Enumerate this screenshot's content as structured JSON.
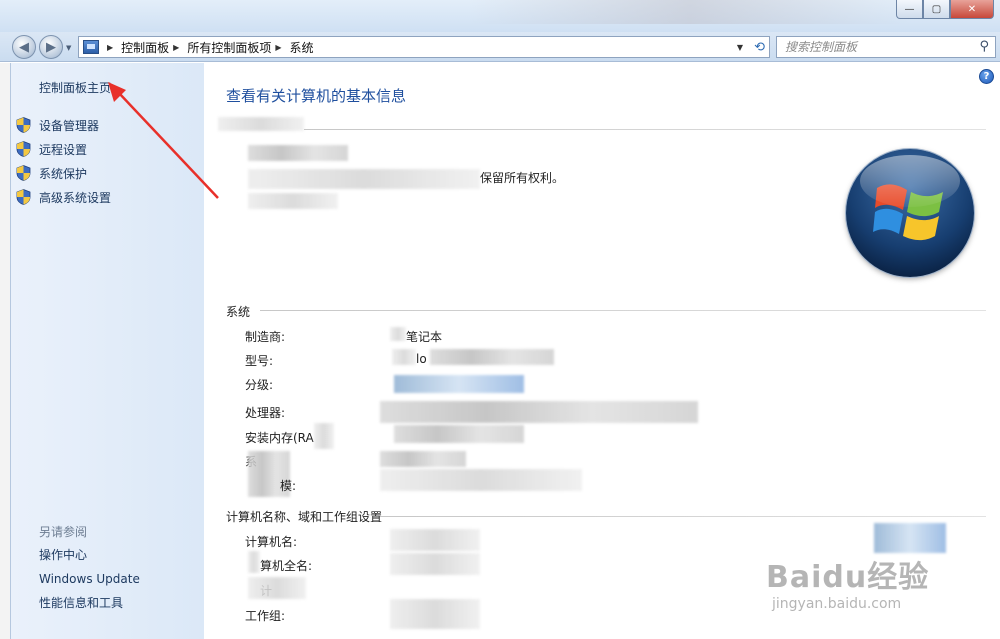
{
  "window": {
    "minimize_glyph": "—",
    "maximize_glyph": "▢",
    "close_glyph": "✕"
  },
  "address_bar": {
    "crumbs": [
      "控制面板",
      "所有控制面板项",
      "系统"
    ],
    "search_placeholder": "搜索控制面板"
  },
  "sidebar": {
    "home": "控制面板主页",
    "items": [
      {
        "label": "设备管理器",
        "icon": "uac-shield-icon"
      },
      {
        "label": "远程设置",
        "icon": "uac-shield-icon"
      },
      {
        "label": "系统保护",
        "icon": "uac-shield-icon"
      },
      {
        "label": "高级系统设置",
        "icon": "uac-shield-icon"
      }
    ],
    "see_also": "另请参阅",
    "links": [
      "操作中心",
      "Windows Update",
      "性能信息和工具"
    ]
  },
  "main": {
    "title": "查看有关计算机的基本信息",
    "rights_text": "保留所有权利。",
    "system_section": "系统",
    "system_rows": {
      "manufacturer_label": "制造商:",
      "manufacturer_value": "笔记本",
      "model_label": "型号:",
      "model_value": "lo",
      "rating_label": "分级:",
      "cpu_label": "处理器:",
      "ram_label": "安装内存(RA",
      "systype_label": "系",
      "pen_label": "模:"
    },
    "computer_section": "计算机名称、域和工作组设置",
    "computer_rows": {
      "name_label": "计算机名:",
      "fullname_label": "算机全名:",
      "desc_label": "计",
      "workgroup_label": "工作组:"
    },
    "help_glyph": "?"
  },
  "watermark": {
    "brand": "Baidu经验",
    "url": "jingyan.baidu.com"
  },
  "colors": {
    "annotation_arrow": "#e8302a",
    "title_blue": "#1f4f9e",
    "link_blue": "#1e3a60"
  }
}
